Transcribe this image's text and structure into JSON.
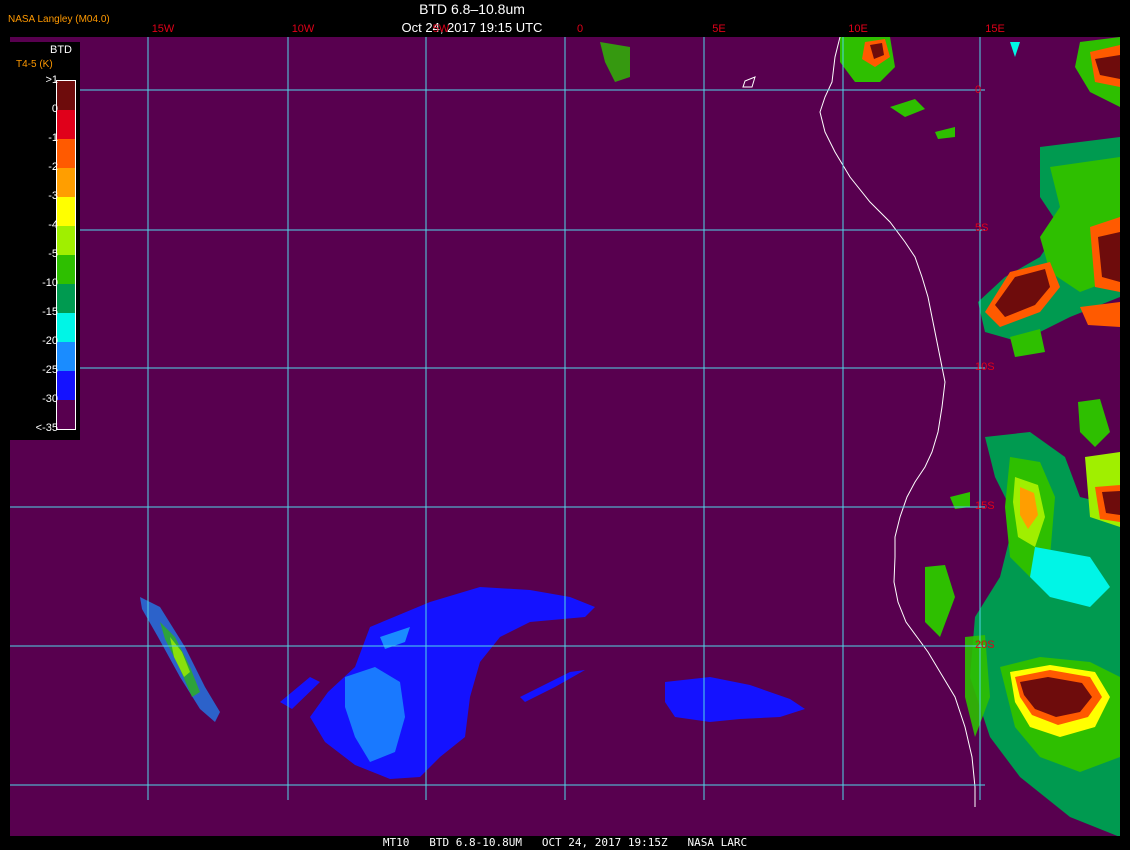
{
  "header": {
    "credit": "NASA Langley (M04.0)",
    "title": "BTD 6.8–10.8um",
    "subtitle": "Oct 24, 2017 19:15 UTC"
  },
  "footer": {
    "caption": "MT10   BTD 6.8-10.8UM   OCT 24, 2017 19:15Z   NASA LARC"
  },
  "grid": {
    "line_color": "#4fd8e8",
    "label_color": "#e0001a",
    "longitude_labels": [
      "15W",
      "10W",
      "5W",
      "0",
      "5E",
      "10E",
      "15E"
    ],
    "latitude_labels": [
      "0",
      "5S",
      "10S",
      "15S",
      "20S"
    ]
  },
  "legend": {
    "title": "BTD",
    "units": "T4-5 (K)",
    "labels": [
      ">1",
      "0",
      "-1",
      "-2",
      "-3",
      "-4",
      "-5",
      "-10",
      "-15",
      "-20",
      "-25",
      "-30",
      "<-35"
    ],
    "colors": [
      "#6e0c0c",
      "#e0001a",
      "#ff5a00",
      "#ff9e00",
      "#ffff00",
      "#a0ef00",
      "#2ebf00",
      "#009a50",
      "#00f5e6",
      "#1a8cff",
      "#1412ff",
      "#58004f"
    ]
  },
  "colors": {
    "background": "#58004f",
    "coastline": "#ffffff"
  }
}
